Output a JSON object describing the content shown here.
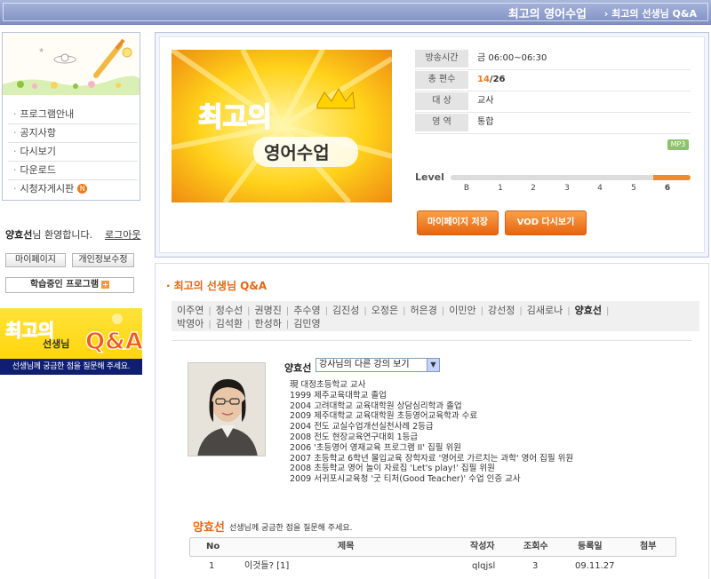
{
  "header": {
    "title": "최고의 영어수업",
    "breadcrumb": "› 최고의 선생님 Q&A"
  },
  "sidebar": {
    "menu": [
      {
        "label": "프로그램안내"
      },
      {
        "label": "공지사항"
      },
      {
        "label": "다시보기"
      },
      {
        "label": "다운로드"
      },
      {
        "label": "시청자게시판",
        "badge": "N"
      }
    ],
    "user_name": "양효선",
    "welcome_suffix": "님 환영합니다.",
    "logout": "로그아웃",
    "mypage_button": "마이페이지",
    "profile_button": "개인정보수정",
    "learning_button": "학습중인 프로그램",
    "banner_title_1": "최고의",
    "banner_title_2": "선생님",
    "banner_title_3": "Q&A",
    "banner_caption": "선생님께 궁금한 점을 질문해 주세요."
  },
  "program": {
    "logo_line1": "최고의",
    "logo_line2": "영어수업",
    "info": [
      {
        "label": "방송시간",
        "value": "금 06:00~06:30"
      },
      {
        "label": "총 편수",
        "value_hl": "14",
        "value": "/26"
      },
      {
        "label": "대    상",
        "value": "교사"
      },
      {
        "label": "영    역",
        "value": "통합"
      }
    ],
    "mp3_badge": "MP3",
    "level_label": "Level",
    "level_ticks": [
      "B",
      "1",
      "2",
      "3",
      "4",
      "5",
      "6"
    ],
    "level_value": 6,
    "save_button": "마이페이지 저장",
    "vod_button": "VOD 다시보기"
  },
  "qa": {
    "title": "최고의 선생님 Q&A",
    "teachers": [
      "이주연",
      "정수선",
      "권명진",
      "추수영",
      "김진성",
      "오정은",
      "허은경",
      "이민안",
      "강선정",
      "김새로나",
      "양효선",
      "박영아",
      "김석환",
      "한성하",
      "김민영"
    ],
    "active_teacher": "양효선",
    "teacher_name": "양효선",
    "select_value": "강사님의 다른 강의 보기",
    "career": [
      "現 대정초등학교 교사",
      "1999 제주교육대학교 졸업",
      "2004 고려대학교 교육대학원 상담심리학과 졸업",
      "2009 제주대학교 교육대학원 초등영어교육학과 수료",
      "2004 전도 교실수업개선실천사례 2등급",
      "2008 전도 현장교육연구대회 1등급",
      "2006 '초등영어 영재교육 프로그램 II' 집필 위원",
      "2007 초등학교 6학년 몰입교육 장학자료 '영어로 가르치는 과학' 영어 집필 위원",
      "2008 초등학교 영어 놀이 자료집 'Let's play!' 집필 위원",
      "2009 서귀포시교육청 '굿 티처(Good Teacher)' 수업 인증 교사"
    ],
    "board_name": "양효선",
    "board_desc": "선생님께 궁금한 점을 질문해 주세요.",
    "columns": [
      "No",
      "제목",
      "작성자",
      "조회수",
      "등록일",
      "첨부"
    ],
    "rows": [
      {
        "no": "1",
        "title": "이것들? [1]",
        "writer": "qlqjsl",
        "views": "3",
        "date": "09.11.27",
        "attach": ""
      }
    ]
  },
  "colors": {
    "accent": "#e8650f",
    "header": "#8d9cc9",
    "menu_border": "#b9c3dd"
  }
}
